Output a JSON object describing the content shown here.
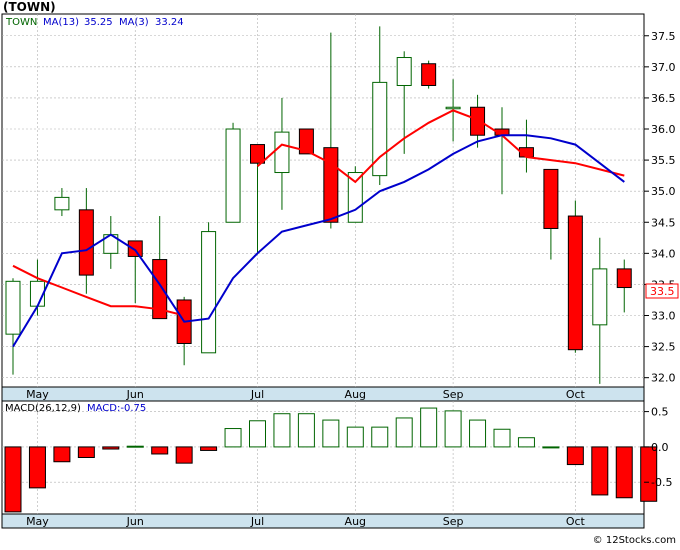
{
  "ticker_title": "(TOWN)",
  "legend": {
    "ticker": "TOWN",
    "ma13_label": "MA(13)",
    "ma13_value": "35.25",
    "ma3_label": "MA(3)",
    "ma3_value": "33.24"
  },
  "macd_legend": {
    "label": "MACD(26,12,9)",
    "value_label": "MACD:-0.75"
  },
  "last_price_label": "33.5",
  "watermark": "© 12Stocks.com",
  "colors": {
    "up": "#ffffff",
    "down": "#ff0000",
    "candle_outline": "#006400",
    "ma13": "#ff0000",
    "ma3": "#0000cc",
    "axis_band": "#cde3ee",
    "grid": "#b0b0b0"
  },
  "chart_data": [
    {
      "type": "candlestick",
      "title": "(TOWN)",
      "x_labels": [
        "May",
        "Jun",
        "Jul",
        "Aug",
        "Sep",
        "Oct"
      ],
      "x_label_index": [
        1,
        5,
        10,
        14,
        18,
        23
      ],
      "ylim": [
        31.85,
        37.85
      ],
      "y_ticks": [
        32.0,
        32.5,
        33.0,
        33.5,
        34.0,
        34.5,
        35.0,
        35.5,
        36.0,
        36.5,
        37.0,
        37.5
      ],
      "grid": true,
      "candles": [
        {
          "o": 32.7,
          "h": 33.6,
          "l": 32.05,
          "c": 33.55
        },
        {
          "o": 33.15,
          "h": 33.9,
          "l": 33.0,
          "c": 33.55
        },
        {
          "o": 34.7,
          "h": 35.05,
          "l": 34.6,
          "c": 34.9
        },
        {
          "o": 34.7,
          "h": 35.05,
          "l": 33.35,
          "c": 33.65
        },
        {
          "o": 34.0,
          "h": 34.6,
          "l": 33.75,
          "c": 34.3
        },
        {
          "o": 34.2,
          "h": 34.2,
          "l": 33.2,
          "c": 33.95
        },
        {
          "o": 33.9,
          "h": 34.6,
          "l": 33.2,
          "c": 32.95
        },
        {
          "o": 33.25,
          "h": 33.3,
          "l": 32.2,
          "c": 32.55
        },
        {
          "o": 32.4,
          "h": 34.5,
          "l": 32.4,
          "c": 34.35
        },
        {
          "o": 34.5,
          "h": 36.1,
          "l": 34.5,
          "c": 36.0
        },
        {
          "o": 35.75,
          "h": 35.75,
          "l": 34.0,
          "c": 35.45
        },
        {
          "o": 35.3,
          "h": 36.5,
          "l": 34.7,
          "c": 35.95
        },
        {
          "o": 36.0,
          "h": 36.0,
          "l": 35.6,
          "c": 35.6
        },
        {
          "o": 35.7,
          "h": 37.55,
          "l": 34.4,
          "c": 34.5
        },
        {
          "o": 34.5,
          "h": 35.4,
          "l": 34.5,
          "c": 35.3
        },
        {
          "o": 35.25,
          "h": 37.65,
          "l": 35.1,
          "c": 36.75
        },
        {
          "o": 36.7,
          "h": 37.25,
          "l": 35.6,
          "c": 37.15
        },
        {
          "o": 37.05,
          "h": 37.1,
          "l": 36.65,
          "c": 36.7
        },
        {
          "o": 36.35,
          "h": 36.8,
          "l": 35.8,
          "c": 36.35
        },
        {
          "o": 36.35,
          "h": 36.55,
          "l": 35.7,
          "c": 35.9
        },
        {
          "o": 36.0,
          "h": 36.35,
          "l": 34.95,
          "c": 35.9
        },
        {
          "o": 35.7,
          "h": 36.15,
          "l": 35.3,
          "c": 35.55
        },
        {
          "o": 35.35,
          "h": 35.35,
          "l": 33.9,
          "c": 34.4
        },
        {
          "o": 34.6,
          "h": 34.85,
          "l": 32.4,
          "c": 32.45
        },
        {
          "o": 32.85,
          "h": 34.25,
          "l": 31.9,
          "c": 33.75
        },
        {
          "o": 33.75,
          "h": 33.9,
          "l": 33.05,
          "c": 33.45
        }
      ],
      "series": [
        {
          "name": "MA(13)",
          "color": "#ff0000",
          "start_index": 0,
          "values": [
            33.8,
            33.6,
            33.45,
            33.3,
            33.15,
            33.15,
            33.1,
            33.0,
            null,
            null,
            35.4,
            35.75,
            35.65,
            35.45,
            35.15,
            35.55,
            35.85,
            36.1,
            36.3,
            36.15,
            35.9,
            35.55,
            35.5,
            35.45,
            35.35,
            35.25
          ]
        },
        {
          "name": "MA(3)",
          "color": "#0000cc",
          "start_index": 0,
          "values": [
            32.5,
            33.15,
            34.0,
            34.05,
            34.3,
            34.05,
            33.5,
            32.9,
            32.95,
            33.6,
            34.0,
            34.35,
            34.45,
            34.55,
            34.7,
            35.0,
            35.15,
            35.35,
            35.6,
            35.8,
            35.9,
            35.9,
            35.85,
            35.75,
            35.45,
            35.15
          ]
        }
      ]
    },
    {
      "type": "bar",
      "title": "MACD(26,12,9)",
      "x_labels": [
        "May",
        "Jun",
        "Jul",
        "Aug",
        "Sep",
        "Oct"
      ],
      "ylim": [
        -0.95,
        0.65
      ],
      "y_ticks": [
        0.5,
        0.0,
        -0.5
      ],
      "y_tick_labels": [
        "0.5",
        "0.0",
        "-0.5"
      ],
      "values": [
        -0.92,
        -0.58,
        -0.21,
        -0.15,
        -0.03,
        0.01,
        -0.1,
        -0.23,
        -0.05,
        0.26,
        0.37,
        0.47,
        0.47,
        0.38,
        0.28,
        0.28,
        0.41,
        0.55,
        0.51,
        0.38,
        0.25,
        0.13,
        0.0,
        -0.25,
        -0.68,
        -0.72,
        -0.77
      ]
    }
  ]
}
